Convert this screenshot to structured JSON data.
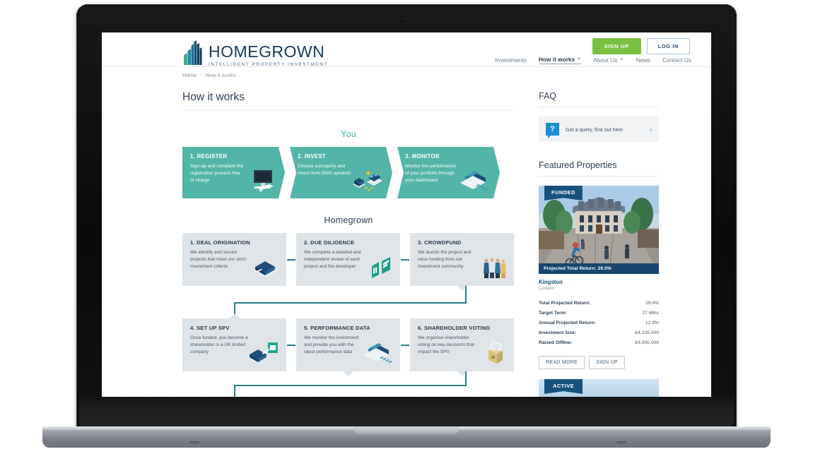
{
  "brand": {
    "name": "HOMEGROWN",
    "tagline": "INTELLIGENT PROPERTY INVESTMENT",
    "logo_icon": "building-logo-icon"
  },
  "auth": {
    "signup_label": "SIGN UP",
    "login_label": "LOG IN",
    "signup_color": "#7ac143"
  },
  "nav": {
    "items": [
      {
        "label": "Investments",
        "active": false,
        "dropdown": false
      },
      {
        "label": "How it works",
        "active": true,
        "dropdown": true
      },
      {
        "label": "About Us",
        "active": false,
        "dropdown": true
      },
      {
        "label": "News",
        "active": false,
        "dropdown": false
      },
      {
        "label": "Contact Us",
        "active": false,
        "dropdown": false
      }
    ]
  },
  "breadcrumb": {
    "home": "Home",
    "separator": "/",
    "current": "How it works"
  },
  "page": {
    "title": "How it works"
  },
  "flow": {
    "you_heading": "You",
    "you_color": "#46b3a4",
    "you_steps": [
      {
        "title": "1. REGISTER",
        "body": "Sign-up and complete the registration process free of charge",
        "icon": "desktop-computer-icon"
      },
      {
        "title": "2. INVEST",
        "body": "Choose a property and invest from £500 upwards",
        "icon": "house-coins-icon"
      },
      {
        "title": "3. MONITOR",
        "body": "Monitor the performance of your portfolio through your dashboard",
        "icon": "chart-dashboard-icon"
      }
    ],
    "homegrown_heading": "Homegrown",
    "homegrown_steps_row1": [
      {
        "title": "1. DEAL ORIGINATION",
        "body": "We identify and secure projects that meet our strict investment criteria",
        "icon": "open-book-icon"
      },
      {
        "title": "2. DUE DILIGENCE",
        "body": "We complete a detailed and independent review of each project and the developer",
        "icon": "documents-icon"
      },
      {
        "title": "3. CROWDFUND",
        "body": "We launch the project and raise funding from our investment community",
        "icon": "people-group-icon"
      }
    ],
    "homegrown_steps_row2": [
      {
        "title": "4. SET UP SPV",
        "body": "Once funded, you become a shareholder in a UK limited company",
        "icon": "book-certificate-icon"
      },
      {
        "title": "5. PERFORMANCE DATA",
        "body": "We monitor the investment and provide you with the latest performance data",
        "icon": "chart-dashboard-icon"
      },
      {
        "title": "6. SHAREHOLDER VOTING",
        "body": "We organise shareholder voting on key decisions that impact the SPV",
        "icon": "ballot-box-icon"
      }
    ],
    "card_teal": "#53b5a7",
    "card_grey": "#dfe4e8",
    "connector_color": "#2a7c86"
  },
  "sidebar": {
    "faq_title": "FAQ",
    "faq_icon": "question-bubble-icon",
    "faq_text": "Got a query, find out here",
    "faq_chevron": "chevron-right-icon",
    "featured_title": "Featured Properties",
    "property": {
      "badge": "FUNDED",
      "caption": "Projected Total Return: 29.0%",
      "name": "Kingston",
      "location": "London",
      "stats": [
        {
          "label": "Total Projected Return:",
          "value": "29.0%"
        },
        {
          "label": "Target Term:",
          "value": "27 Mths"
        },
        {
          "label": "Annual Projected Return:",
          "value": "12.9%"
        },
        {
          "label": "Investment Size:",
          "value": "£4,105,000"
        },
        {
          "label": "Raised Offline:",
          "value": "£4,000,000"
        }
      ],
      "read_more_label": "READ MORE",
      "sign_up_label": "SIGN UP"
    },
    "property2": {
      "badge": "ACTIVE"
    }
  }
}
